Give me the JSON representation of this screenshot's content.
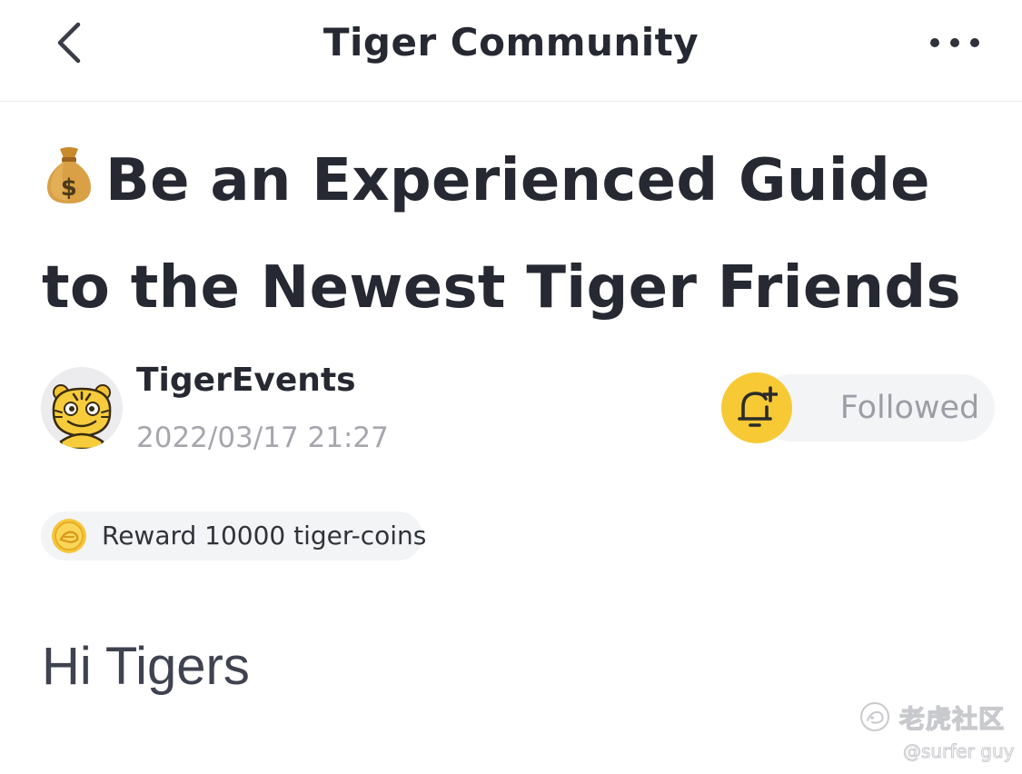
{
  "navbar": {
    "title": "Tiger Community",
    "back_icon": "chevron-left-icon",
    "more_icon": "more-dots-icon"
  },
  "article": {
    "title_emoji": "money-bag-icon",
    "title": "Be an Experienced Guide to the Newest Tiger Friends",
    "author": {
      "name": "TigerEvents",
      "time": "2022/03/17 21:27",
      "avatar_icon": "tiger-avatar-icon"
    },
    "follow": {
      "label": "Followed",
      "bell_icon": "bell-plus-icon"
    },
    "reward": {
      "icon": "tiger-coin-icon",
      "text": "Reward 10000 tiger-coins"
    },
    "body_heading": "Hi Tigers"
  },
  "watermark": {
    "brand": "老虎社区",
    "user": "@surfer guy"
  },
  "colors": {
    "accent_yellow": "#f6c935",
    "text_primary": "#262931",
    "text_secondary": "#a5a7ad",
    "chip_bg": "#f3f4f6"
  }
}
